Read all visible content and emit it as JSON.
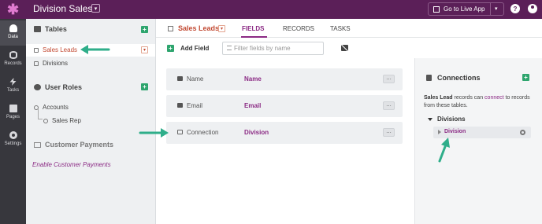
{
  "app": {
    "title": "Division Sales",
    "live_button": "Go to Live App"
  },
  "rail": {
    "items": [
      {
        "label": "Data",
        "icon": "database-icon"
      },
      {
        "label": "Records",
        "icon": "records-icon"
      },
      {
        "label": "Tasks",
        "icon": "lightning-icon"
      },
      {
        "label": "Pages",
        "icon": "pages-icon"
      },
      {
        "label": "Settings",
        "icon": "gear-icon"
      }
    ]
  },
  "sidebar": {
    "tables_heading": "Tables",
    "tables": [
      "Sales Leads",
      "Divisions"
    ],
    "roles_heading": "User Roles",
    "roles": [
      "Accounts",
      "Sales Rep"
    ],
    "payments_heading": "Customer Payments",
    "enable_payments": "Enable Customer Payments"
  },
  "main": {
    "table_title": "Sales Leads",
    "tabs": [
      "FIELDS",
      "RECORDS",
      "TASKS"
    ],
    "active_tab": "FIELDS",
    "add_field": "Add Field",
    "filter_placeholder": "Filter fields by name",
    "fields": [
      {
        "name": "Name",
        "type": "Name"
      },
      {
        "name": "Email",
        "type": "Email"
      },
      {
        "name": "Connection",
        "type": "Division"
      }
    ]
  },
  "connections": {
    "title": "Connections",
    "desc_table": "Sales Lead",
    "desc_mid": " records can ",
    "desc_link": "connect",
    "desc_end": " to records from these tables.",
    "group": "Divisions",
    "items": [
      "Division"
    ]
  },
  "colors": {
    "topbar": "#5b1f58",
    "accent": "#8b2a84",
    "table_active": "#c24a33",
    "plus": "#2ea56e",
    "arrow": "#2fae8a"
  }
}
